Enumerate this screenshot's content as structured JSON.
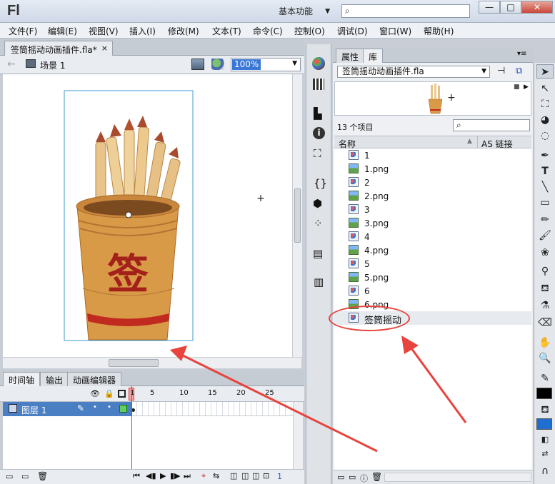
{
  "app": {
    "logo": "Fl",
    "workspace": "基本功能"
  },
  "window_buttons": {
    "minimize": "—",
    "maximize": "□",
    "close": "✕"
  },
  "menu": [
    "文件(F)",
    "编辑(E)",
    "视图(V)",
    "插入(I)",
    "修改(M)",
    "文本(T)",
    "命令(C)",
    "控制(O)",
    "调试(D)",
    "窗口(W)",
    "帮助(H)"
  ],
  "document": {
    "tab_title": "签筒摇动动画插件.fla*",
    "close": "×",
    "scene": "场景 1",
    "zoom": "100%"
  },
  "timeline": {
    "tabs": [
      "时间轴",
      "输出",
      "动画编辑器"
    ],
    "frame_numbers": [
      "1",
      "5",
      "10",
      "15",
      "20",
      "25"
    ],
    "layer_name": "图层 1",
    "current_frame": "1"
  },
  "panel": {
    "tabs": [
      "属性",
      "库"
    ],
    "library_file": "签筒摇动动画插件.fla",
    "item_count": "13 个项目",
    "col_name": "名称",
    "col_link": "AS 链接",
    "items": [
      {
        "name": "1",
        "type": "graphic"
      },
      {
        "name": "1.png",
        "type": "bitmap"
      },
      {
        "name": "2",
        "type": "graphic"
      },
      {
        "name": "2.png",
        "type": "bitmap"
      },
      {
        "name": "3",
        "type": "graphic"
      },
      {
        "name": "3.png",
        "type": "bitmap"
      },
      {
        "name": "4",
        "type": "graphic"
      },
      {
        "name": "4.png",
        "type": "bitmap"
      },
      {
        "name": "5",
        "type": "graphic"
      },
      {
        "name": "5.png",
        "type": "bitmap"
      },
      {
        "name": "6",
        "type": "graphic"
      },
      {
        "name": "6.png",
        "type": "bitmap"
      },
      {
        "name": "签筒摇动",
        "type": "movieclip"
      }
    ]
  },
  "stage": {
    "cup_glyph": "签"
  },
  "colors": {
    "annotation": "#e8433c",
    "selection": "#3a77d6",
    "playhead": "#d83a3a"
  }
}
